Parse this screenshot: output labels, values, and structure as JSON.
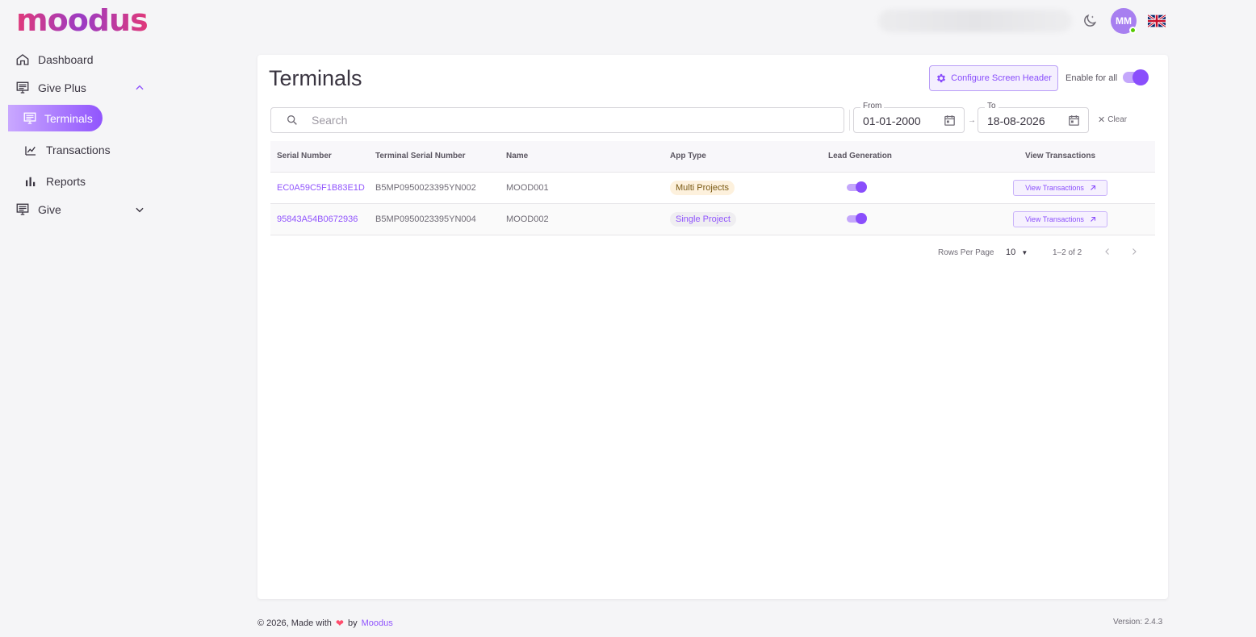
{
  "brand": {
    "logo_text": "moodus",
    "accent": "#9155fd"
  },
  "header": {
    "avatar_initials": "MM"
  },
  "sidebar": {
    "items": [
      {
        "label": "Dashboard",
        "icon": "home-icon"
      },
      {
        "label": "Give Plus",
        "icon": "monitor-icon",
        "expanded": true
      },
      {
        "label": "Terminals",
        "icon": "monitor-icon",
        "active": true
      },
      {
        "label": "Transactions",
        "icon": "chart-icon"
      },
      {
        "label": "Reports",
        "icon": "bar-chart-icon"
      },
      {
        "label": "Give",
        "icon": "monitor-icon",
        "expanded": false
      }
    ]
  },
  "main": {
    "title": "Terminals",
    "configure_label": "Configure Screen Header",
    "enable_all_label": "Enable for all",
    "enable_all_on": true,
    "search_placeholder": "Search",
    "date_from_label": "From",
    "date_from": "01-01-2000",
    "date_to_label": "To",
    "date_to": "18-08-2026",
    "clear_label": "Clear",
    "table": {
      "headers": [
        "Serial Number",
        "Terminal Serial Number",
        "Name",
        "App Type",
        "Lead Generation",
        "View Transactions"
      ],
      "rows": [
        {
          "serial": "EC0A59C5F1B83E1D",
          "terminal_serial": "B5MP0950023395YN002",
          "name": "MOOD001",
          "app_type": "Multi Projects",
          "lead_generation": true,
          "view_label": "View Transactions"
        },
        {
          "serial": "95843A54B0672936",
          "terminal_serial": "B5MP0950023395YN004",
          "name": "MOOD002",
          "app_type": "Single Project",
          "lead_generation": true,
          "view_label": "View Transactions"
        }
      ]
    },
    "pagination": {
      "rows_per_page_label": "Rows Per Page",
      "rows_per_page": "10",
      "range": "1–2 of 2"
    }
  },
  "footer": {
    "left_prefix": "© 2026, Made with",
    "left_by": "by",
    "left_brand": "Moodus",
    "version": "Version: 2.4.3"
  }
}
